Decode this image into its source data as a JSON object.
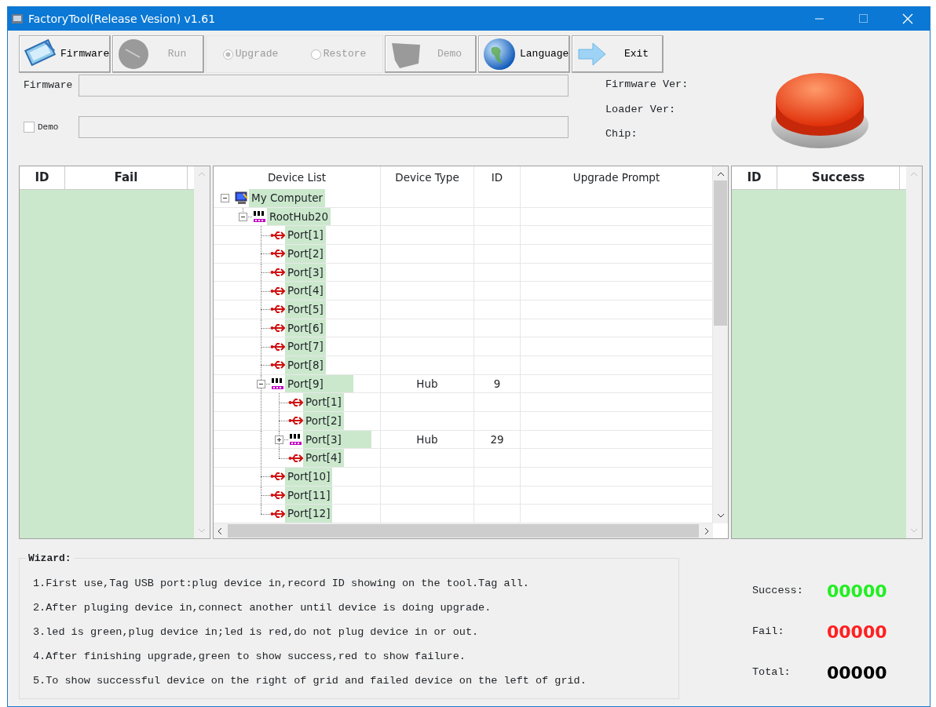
{
  "window": {
    "title": "FactoryTool(Release Vesion) v1.61"
  },
  "toolbar": [
    {
      "kind": "button",
      "label": "Firmware",
      "disabled": false
    },
    {
      "kind": "button",
      "label": "Run",
      "disabled": true
    },
    {
      "kind": "radios",
      "options": [
        {
          "label": "Upgrade",
          "selected": true,
          "disabled": true
        },
        {
          "label": "Restore",
          "selected": false,
          "disabled": true
        }
      ]
    },
    {
      "kind": "button",
      "label": "Demo",
      "disabled": true
    },
    {
      "kind": "button",
      "label": "Language",
      "disabled": false
    },
    {
      "kind": "button",
      "label": "Exit",
      "disabled": false
    }
  ],
  "firmware_field": {
    "label": "Firmware"
  },
  "demo": {
    "label": "Demo",
    "checked": false
  },
  "info_labels": [
    "Firmware Ver:",
    "Loader Ver:",
    "Chip:"
  ],
  "fail_grid": {
    "columns": [
      "ID",
      "Fail"
    ]
  },
  "device_table": {
    "columns": [
      "Device List",
      "Device Type",
      "ID",
      "Upgrade Prompt"
    ],
    "tree": [
      {
        "kind": "computer",
        "label": "My Computer",
        "expanded": true,
        "children": [
          {
            "kind": "hub",
            "label": "RootHub20",
            "expanded": true,
            "children": [
              {
                "kind": "port",
                "label": "Port[1]"
              },
              {
                "kind": "port",
                "label": "Port[2]"
              },
              {
                "kind": "port",
                "label": "Port[3]"
              },
              {
                "kind": "port",
                "label": "Port[4]"
              },
              {
                "kind": "port",
                "label": "Port[5]"
              },
              {
                "kind": "port",
                "label": "Port[6]"
              },
              {
                "kind": "port",
                "label": "Port[7]"
              },
              {
                "kind": "port",
                "label": "Port[8]"
              },
              {
                "kind": "hub",
                "label": "Port[9]",
                "type": "Hub",
                "id": "9",
                "expanded": true,
                "children": [
                  {
                    "kind": "port",
                    "label": "Port[1]"
                  },
                  {
                    "kind": "port",
                    "label": "Port[2]"
                  },
                  {
                    "kind": "hub",
                    "label": "Port[3]",
                    "type": "Hub",
                    "id": "29",
                    "expanded": false
                  },
                  {
                    "kind": "port",
                    "label": "Port[4]"
                  }
                ]
              },
              {
                "kind": "port",
                "label": "Port[10]"
              },
              {
                "kind": "port",
                "label": "Port[11]"
              },
              {
                "kind": "port",
                "label": "Port[12]"
              }
            ]
          }
        ]
      }
    ]
  },
  "success_grid": {
    "columns": [
      "ID",
      "Success"
    ]
  },
  "wizard": {
    "title": "Wizard:",
    "steps": [
      "1.First use,Tag USB port:plug device in,record ID showing on the tool.Tag all.",
      "2.After pluging device in,connect another until device is doing upgrade.",
      "3.led is green,plug device in;led is red,do not plug device in or out.",
      "4.After finishing upgrade,green to show success,red to show failure.",
      "5.To show successful device on the right of grid and failed device on the left of grid."
    ]
  },
  "counters": [
    {
      "label": "Success:",
      "value": "00000",
      "color": "#22ee22"
    },
    {
      "label": "Fail:",
      "value": "00000",
      "color": "#ff2020"
    },
    {
      "label": "Total:",
      "value": "00000",
      "color": "#000000"
    }
  ]
}
